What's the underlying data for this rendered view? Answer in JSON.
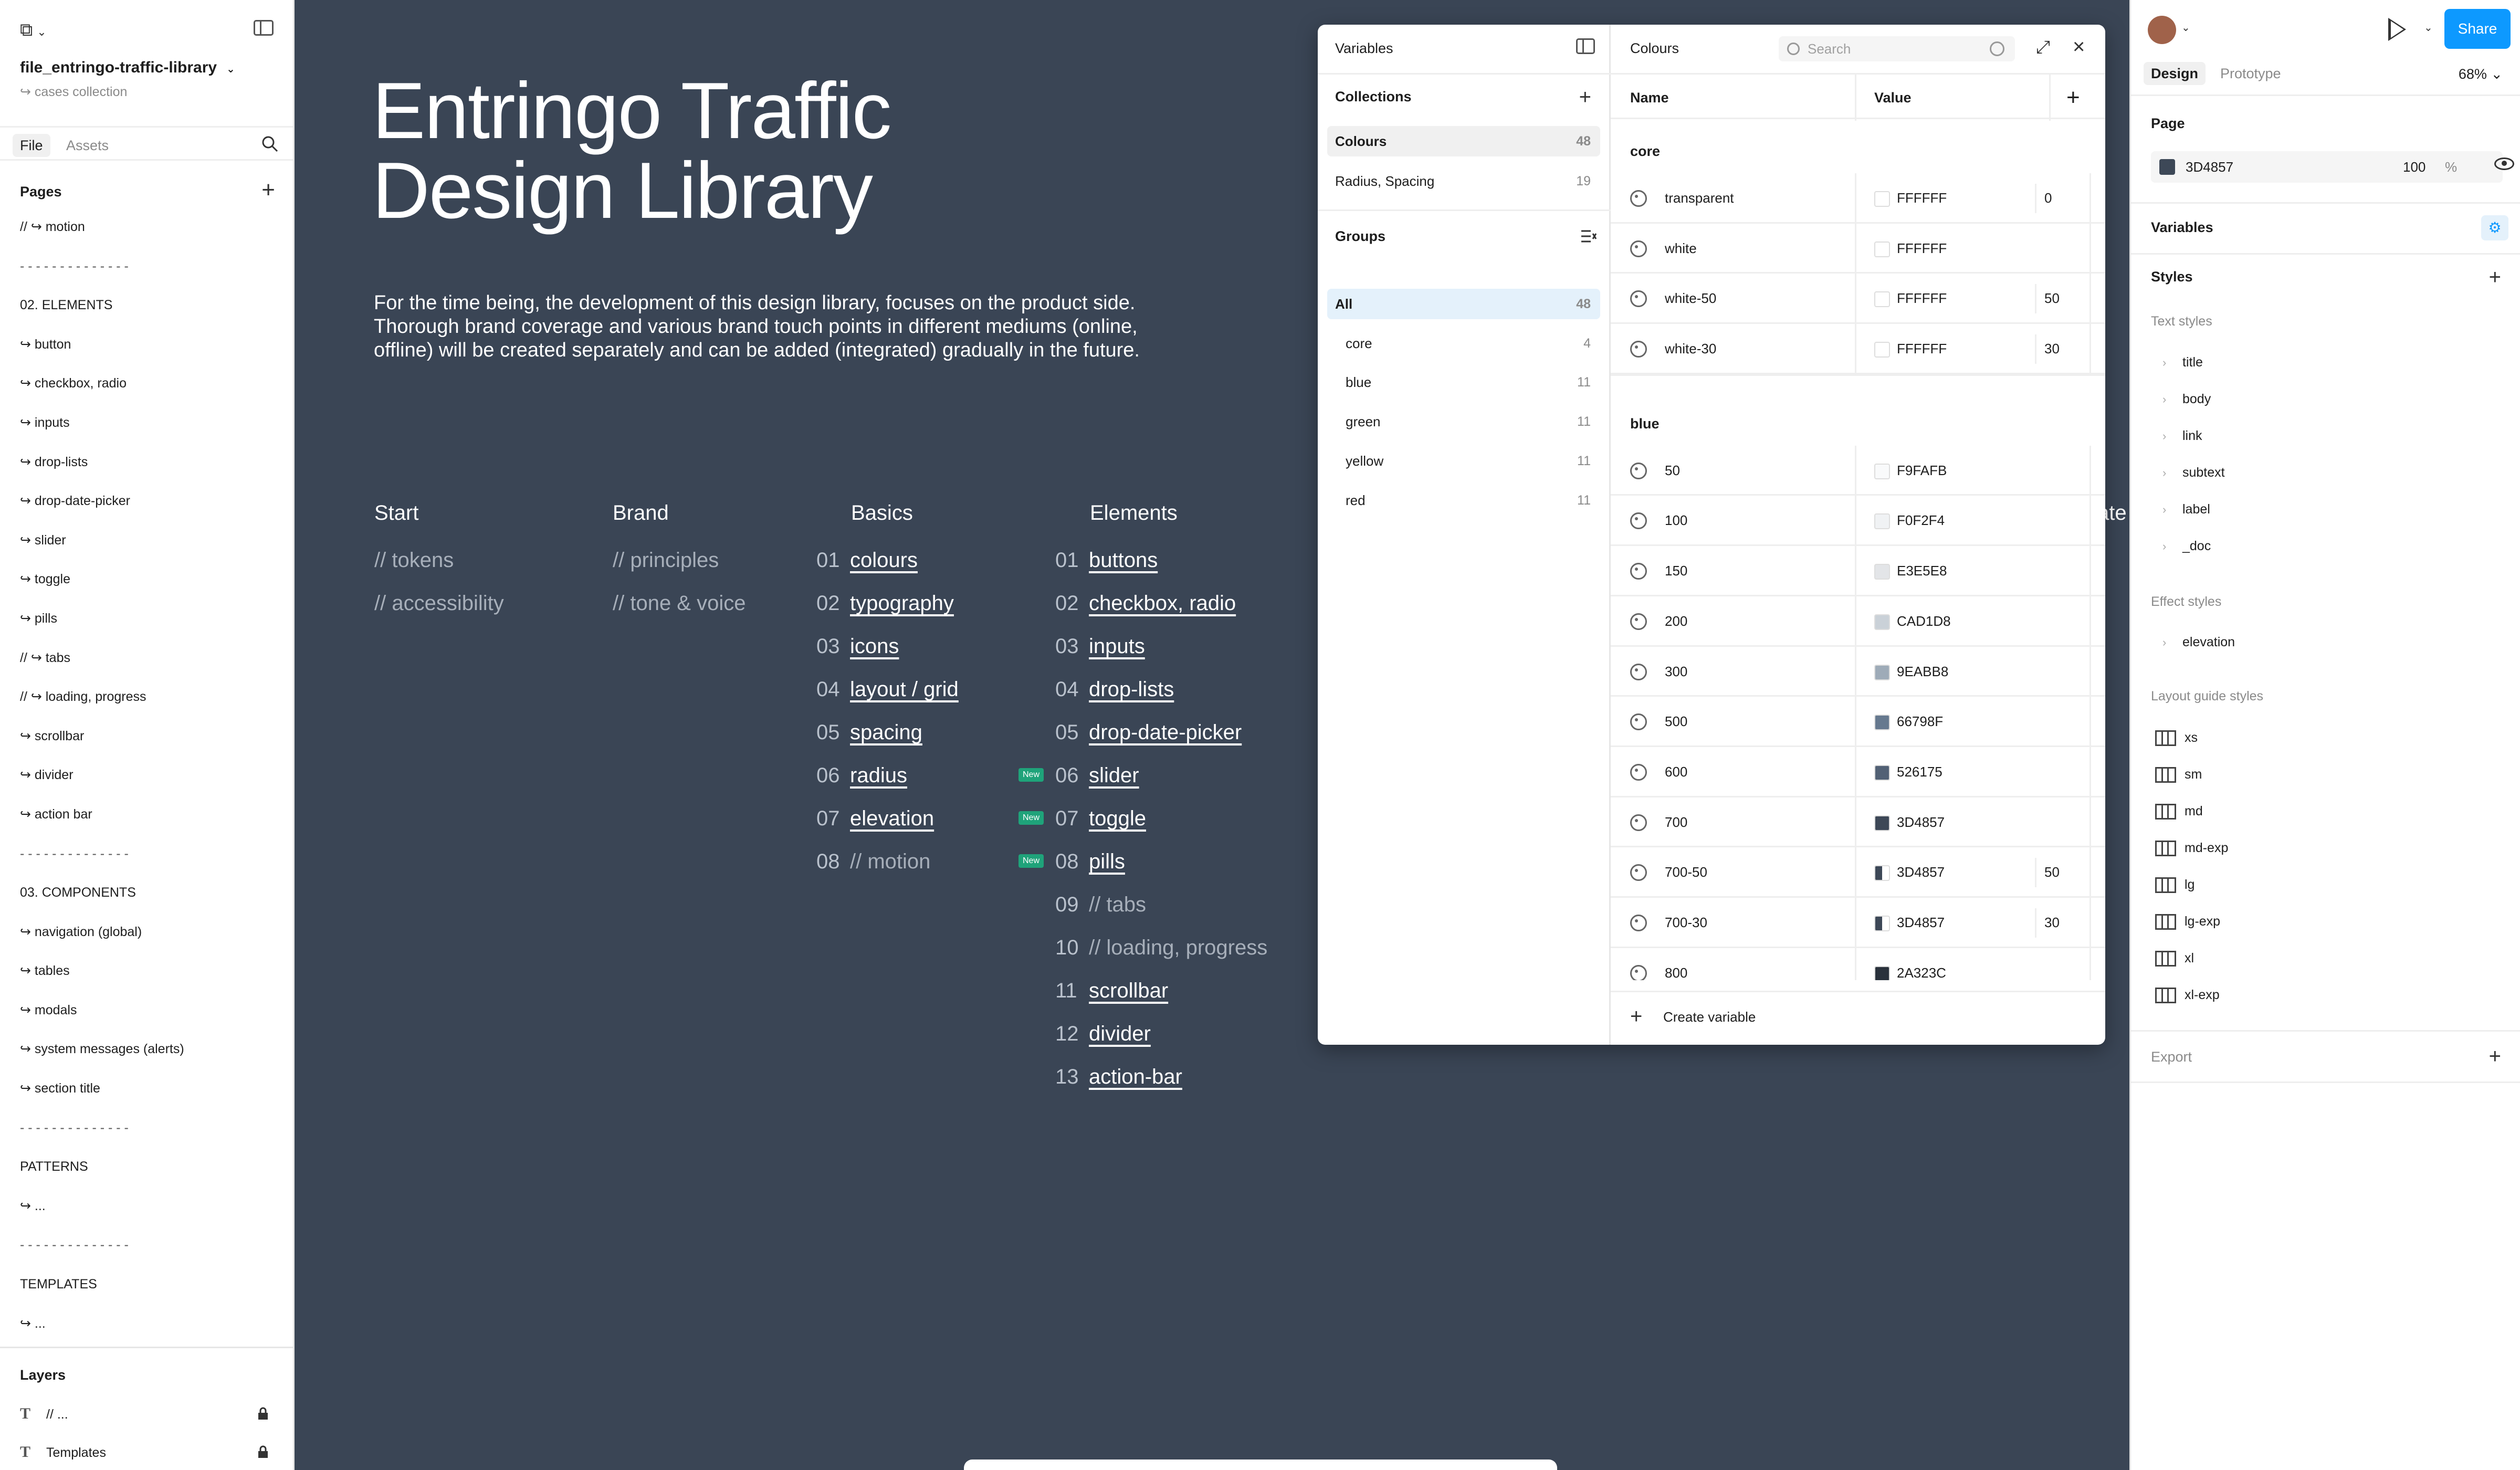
{
  "left": {
    "file_name": "file_entringo-traffic-library",
    "file_sub": "↪ cases collection",
    "tabs": [
      "File",
      "Assets"
    ],
    "pages_header": "Pages",
    "pages": [
      "// ↪ motion",
      "- - - - - - - - - - - - - -",
      "02. ELEMENTS",
      "↪ button",
      "↪ checkbox, radio",
      "↪ inputs",
      "↪ drop-lists",
      "↪ drop-date-picker",
      "↪ slider",
      "↪ toggle",
      "↪ pills",
      "// ↪ tabs",
      "// ↪ loading, progress",
      "↪ scrollbar",
      "↪ divider",
      "↪ action bar",
      "- - - - - - - - - - - - - -",
      "03. COMPONENTS",
      "↪ navigation (global)",
      "↪ tables",
      "↪ modals",
      "↪ system messages (alerts)",
      "↪ section title",
      "- - - - - - - - - - - - - -",
      "PATTERNS",
      "↪ ...",
      "- - - - - - - - - - - - - -",
      "TEMPLATES",
      "↪ ..."
    ],
    "layers_header": "Layers",
    "layers": [
      "// ...",
      "Templates"
    ]
  },
  "canvas": {
    "title_line1": "Entringo Traffic",
    "title_line2": "Design Library",
    "description": "For the time being, the development of this design library, focuses on the product side. Thorough brand coverage and various brand touch points in different mediums (online, offline) will be created separately and can be added (integrated) gradually in the future.",
    "stray_text": "ate",
    "new_badge": "New",
    "columns": {
      "start": {
        "title": "Start",
        "items": [
          "// tokens",
          "// accessibility"
        ]
      },
      "brand": {
        "title": "Brand",
        "items": [
          "// principles",
          "// tone & voice"
        ]
      },
      "basics": {
        "title": "Basics",
        "items": [
          {
            "n": "01",
            "label": "colours"
          },
          {
            "n": "02",
            "label": "typography"
          },
          {
            "n": "03",
            "label": "icons"
          },
          {
            "n": "04",
            "label": "layout / grid"
          },
          {
            "n": "05",
            "label": "spacing"
          },
          {
            "n": "06",
            "label": "radius"
          },
          {
            "n": "07",
            "label": "elevation"
          },
          {
            "n": "08",
            "label": "// motion"
          }
        ]
      },
      "elements": {
        "title": "Elements",
        "items": [
          {
            "n": "01",
            "label": "buttons"
          },
          {
            "n": "02",
            "label": "checkbox, radio"
          },
          {
            "n": "03",
            "label": "inputs"
          },
          {
            "n": "04",
            "label": "drop-lists"
          },
          {
            "n": "05",
            "label": "drop-date-picker"
          },
          {
            "n": "06",
            "label": "slider"
          },
          {
            "n": "07",
            "label": "toggle"
          },
          {
            "n": "08",
            "label": "pills"
          },
          {
            "n": "09",
            "label": "// tabs"
          },
          {
            "n": "10",
            "label": "// loading, progress"
          },
          {
            "n": "11",
            "label": "scrollbar"
          },
          {
            "n": "12",
            "label": "divider"
          },
          {
            "n": "13",
            "label": "action-bar"
          }
        ]
      }
    }
  },
  "variables": {
    "title": "Variables",
    "collections_header": "Collections",
    "collections": [
      {
        "name": "Colours",
        "count": "48"
      },
      {
        "name": "Radius, Spacing",
        "count": "19"
      }
    ],
    "groups_header": "Groups",
    "groups": [
      {
        "name": "All",
        "count": "48"
      },
      {
        "name": "core",
        "count": "4"
      },
      {
        "name": "blue",
        "count": "11"
      },
      {
        "name": "green",
        "count": "11"
      },
      {
        "name": "yellow",
        "count": "11"
      },
      {
        "name": "red",
        "count": "11"
      }
    ],
    "panel_title": "Colours",
    "search_placeholder": "Search",
    "col_name": "Name",
    "col_value": "Value",
    "group_core": "core",
    "core_rows": [
      {
        "name": "transparent",
        "hex": "FFFFFF",
        "alpha": "0",
        "color": "#ffffff"
      },
      {
        "name": "white",
        "hex": "FFFFFF",
        "alpha": "",
        "color": "#ffffff"
      },
      {
        "name": "white-50",
        "hex": "FFFFFF",
        "alpha": "50",
        "color": "#ffffff"
      },
      {
        "name": "white-30",
        "hex": "FFFFFF",
        "alpha": "30",
        "color": "#ffffff"
      }
    ],
    "group_blue": "blue",
    "blue_rows": [
      {
        "name": "50",
        "hex": "F9FAFB",
        "alpha": "",
        "color": "#f9fafb"
      },
      {
        "name": "100",
        "hex": "F0F2F4",
        "alpha": "",
        "color": "#f0f2f4"
      },
      {
        "name": "150",
        "hex": "E3E5E8",
        "alpha": "",
        "color": "#e3e5e8"
      },
      {
        "name": "200",
        "hex": "CAD1D8",
        "alpha": "",
        "color": "#cad1d8"
      },
      {
        "name": "300",
        "hex": "9EABB8",
        "alpha": "",
        "color": "#9eabb8"
      },
      {
        "name": "500",
        "hex": "66798F",
        "alpha": "",
        "color": "#66798f"
      },
      {
        "name": "600",
        "hex": "526175",
        "alpha": "",
        "color": "#526175"
      },
      {
        "name": "700",
        "hex": "3D4857",
        "alpha": "",
        "color": "#3d4857"
      },
      {
        "name": "700-50",
        "hex": "3D4857",
        "alpha": "50",
        "color": "#3d4857"
      },
      {
        "name": "700-30",
        "hex": "3D4857",
        "alpha": "30",
        "color": "#3d4857"
      },
      {
        "name": "800",
        "hex": "2A323C",
        "alpha": "",
        "color": "#2a323c"
      }
    ],
    "create_label": "Create variable"
  },
  "right": {
    "share_label": "Share",
    "tabs": [
      "Design",
      "Prototype"
    ],
    "zoom": "68%",
    "page_header": "Page",
    "page_fill_hex": "3D4857",
    "page_fill_opacity": "100",
    "page_fill_pct": "%",
    "page_fill_color": "#3d4857",
    "variables_header": "Variables",
    "styles_header": "Styles",
    "text_styles_header": "Text styles",
    "text_styles": [
      "title",
      "body",
      "link",
      "subtext",
      "label",
      "_doc"
    ],
    "effect_styles_header": "Effect styles",
    "effect_styles": [
      "elevation"
    ],
    "layout_styles_header": "Layout guide styles",
    "layout_styles": [
      "xs",
      "sm",
      "md",
      "md-exp",
      "lg",
      "lg-exp",
      "xl",
      "xl-exp"
    ],
    "export_header": "Export",
    "accent": "#0d99ff"
  }
}
